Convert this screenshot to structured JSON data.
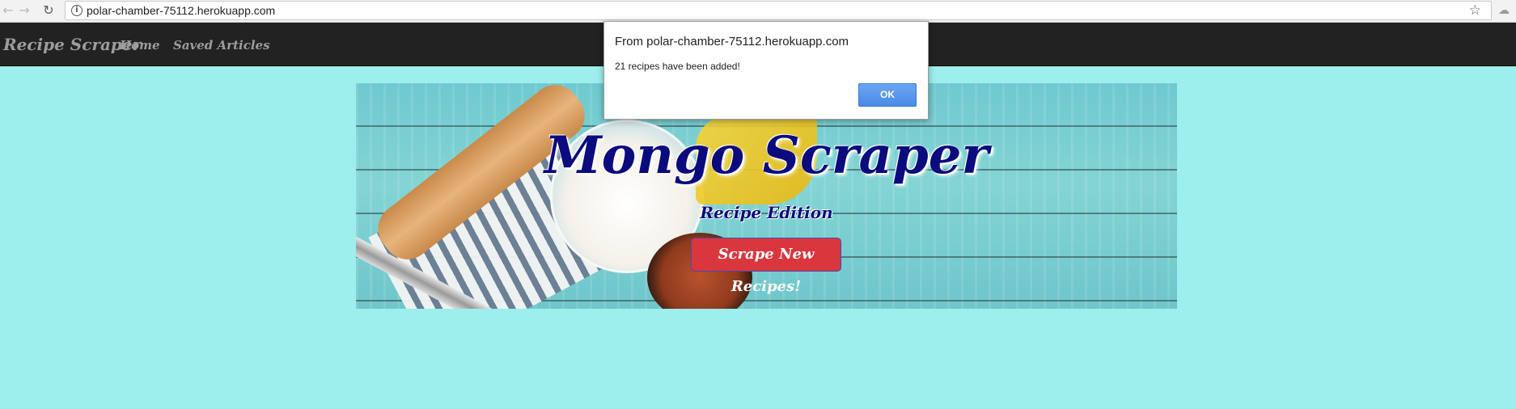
{
  "browser": {
    "url": "polar-chamber-75112.herokuapp.com",
    "icons": {
      "back": "back-arrow-icon",
      "forward": "forward-arrow-icon",
      "reload": "reload-icon",
      "info": "info-icon",
      "bookmark": "star-icon",
      "extension": "extension-icon"
    }
  },
  "navbar": {
    "brand": "Recipe Scraper",
    "links": [
      {
        "label": "Home"
      },
      {
        "label": "Saved Articles"
      }
    ],
    "background": "#222222",
    "text_color": "#9d9d9d"
  },
  "banner": {
    "title": "Mongo Scraper",
    "subtitle": "Recipe Edition",
    "button_label": "Scrape New Recipes!",
    "title_color": "#0b0b7e",
    "button_color": "#d9363e"
  },
  "dialog": {
    "title": "From polar-chamber-75112.herokuapp.com",
    "message": "21 recipes have been added!",
    "ok_label": "OK"
  },
  "page": {
    "background": "#9defed"
  }
}
